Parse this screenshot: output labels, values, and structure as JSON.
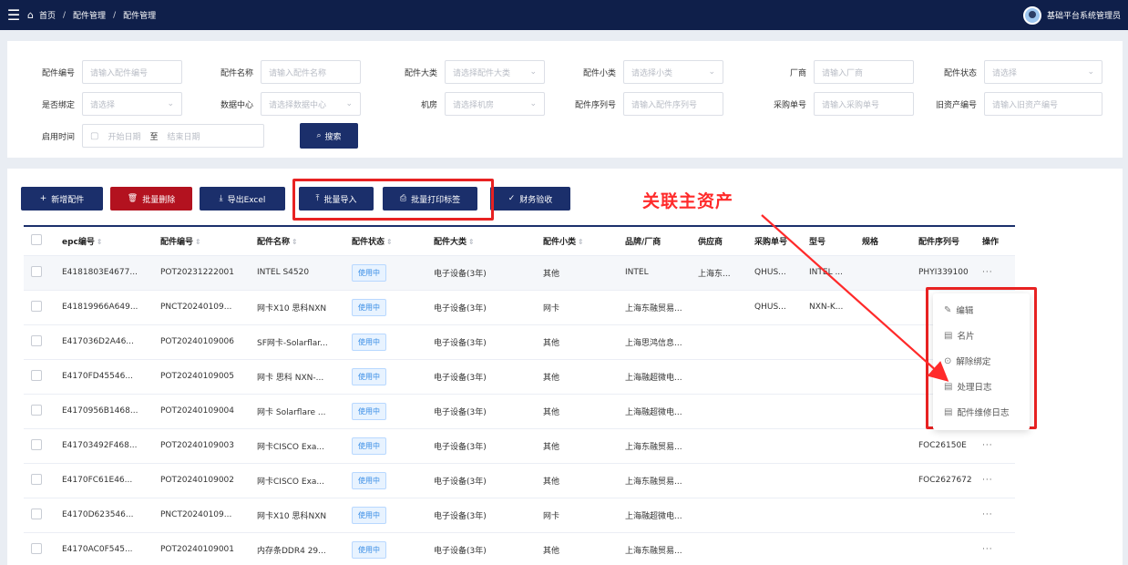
{
  "topbar": {
    "menu_icon": "hamburger-icon",
    "breadcrumbs": [
      "首页",
      "配件管理",
      "配件管理"
    ],
    "separator": "/",
    "user_name": "基础平台系统管理员"
  },
  "filters": {
    "row1": [
      {
        "label": "配件编号",
        "placeholder": "请输入配件编号",
        "type": "input"
      },
      {
        "label": "配件名称",
        "placeholder": "请输入配件名称",
        "type": "input"
      },
      {
        "label": "配件大类",
        "placeholder": "请选择配件大类",
        "type": "select"
      },
      {
        "label": "配件小类",
        "placeholder": "请选择小类",
        "type": "select"
      },
      {
        "label": "厂商",
        "placeholder": "请输入厂商",
        "type": "input"
      },
      {
        "label": "配件状态",
        "placeholder": "请选择",
        "type": "select"
      }
    ],
    "row2": [
      {
        "label": "是否绑定",
        "placeholder": "请选择",
        "type": "select"
      },
      {
        "label": "数据中心",
        "placeholder": "请选择数据中心",
        "type": "select"
      },
      {
        "label": "机房",
        "placeholder": "请选择机房",
        "type": "select"
      },
      {
        "label": "配件序列号",
        "placeholder": "请输入配件序列号",
        "type": "input"
      },
      {
        "label": "采购单号",
        "placeholder": "请输入采购单号",
        "type": "input"
      },
      {
        "label": "旧资产编号",
        "placeholder": "请输入旧资产编号",
        "type": "input"
      }
    ],
    "date": {
      "label": "启用时间",
      "start_placeholder": "开始日期",
      "to": "至",
      "end_placeholder": "结束日期"
    },
    "search_label": "搜索"
  },
  "toolbar": {
    "add": "新增配件",
    "batch_delete": "批量删除",
    "export": "导出Excel",
    "batch_import": "批量导入",
    "batch_print": "批量打印标签",
    "finance_check": "财务验收"
  },
  "annotation": {
    "text": "关联主资产",
    "color": "#ff2a2a"
  },
  "table": {
    "columns": [
      "epc编号",
      "配件编号",
      "配件名称",
      "配件状态",
      "配件大类",
      "配件小类",
      "品牌/厂商",
      "供应商",
      "采购单号",
      "型号",
      "规格",
      "配件序列号",
      "操作"
    ],
    "sort_icon": "⇕",
    "rows": [
      [
        "E4181803E4677...",
        "POT20231222001",
        "INTEL S4520",
        "使用中",
        "电子设备(3年)",
        "其他",
        "INTEL",
        "上海东...",
        "QHUS...",
        "INTEL ...",
        "",
        "PHYI339100",
        "···"
      ],
      [
        "E41819966A649...",
        "PNCT20240109...",
        "网卡X10 思科NXN",
        "使用中",
        "电子设备(3年)",
        "网卡",
        "上海东融贸易...",
        "",
        "QHUS...",
        "NXN-K...",
        "",
        "",
        ""
      ],
      [
        "E417036D2A46...",
        "POT20240109006",
        "SF网卡-Solarflar...",
        "使用中",
        "电子设备(3年)",
        "其他",
        "上海思鸿信息...",
        "",
        "",
        "",
        "",
        "",
        ""
      ],
      [
        "E4170FD45546...",
        "POT20240109005",
        "网卡 思科 NXN-...",
        "使用中",
        "电子设备(3年)",
        "其他",
        "上海融超微电...",
        "",
        "",
        "",
        "",
        "",
        ""
      ],
      [
        "E4170956B1468...",
        "POT20240109004",
        "网卡 Solarflare ...",
        "使用中",
        "电子设备(3年)",
        "其他",
        "上海融超微电...",
        "",
        "",
        "",
        "",
        "",
        ""
      ],
      [
        "E41703492F468...",
        "POT20240109003",
        "网卡CISCO Exa...",
        "使用中",
        "电子设备(3年)",
        "其他",
        "上海东融贸易...",
        "",
        "",
        "",
        "",
        "FOC26150E",
        "···"
      ],
      [
        "E4170FC61E46...",
        "POT20240109002",
        "网卡CISCO Exa...",
        "使用中",
        "电子设备(3年)",
        "其他",
        "上海东融贸易...",
        "",
        "",
        "",
        "",
        "FOC2627672",
        "···"
      ],
      [
        "E4170D623546...",
        "PNCT20240109...",
        "网卡X10 思科NXN",
        "使用中",
        "电子设备(3年)",
        "网卡",
        "上海融超微电...",
        "",
        "",
        "",
        "",
        "",
        "···"
      ],
      [
        "E4170AC0F545...",
        "POT20240109001",
        "内存条DDR4 29...",
        "使用中",
        "电子设备(3年)",
        "其他",
        "上海东融贸易...",
        "",
        "",
        "",
        "",
        "",
        "···"
      ]
    ]
  },
  "dropdown": {
    "items": [
      {
        "icon": "edit-icon",
        "glyph": "✎",
        "label": "编辑"
      },
      {
        "icon": "card-icon",
        "glyph": "▤",
        "label": "名片"
      },
      {
        "icon": "unbind-icon",
        "glyph": "⊙",
        "label": "解除绑定"
      },
      {
        "icon": "log-icon",
        "glyph": "▤",
        "label": "处理日志"
      },
      {
        "icon": "repair-log-icon",
        "glyph": "▤",
        "label": "配件维修日志"
      }
    ]
  }
}
